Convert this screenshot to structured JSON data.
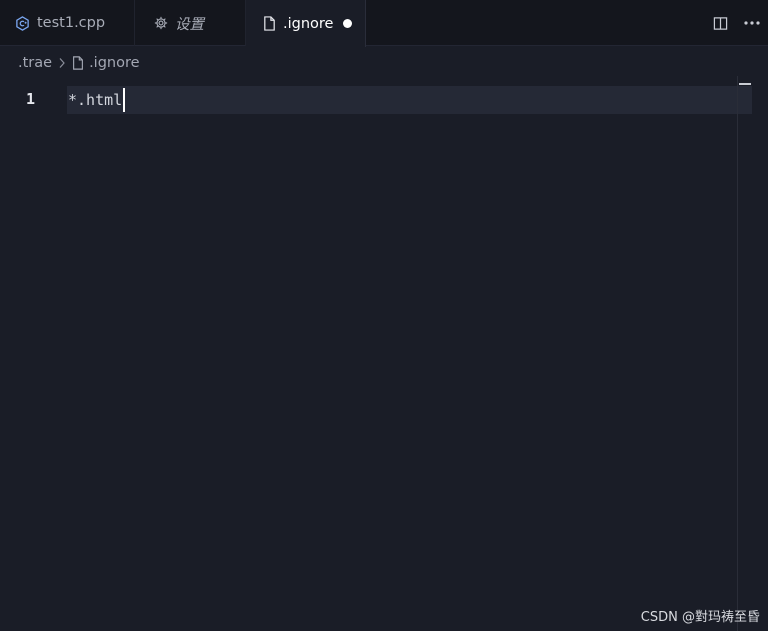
{
  "tabs": [
    {
      "label": "test1.cpp",
      "icon": "cpp-file-icon"
    },
    {
      "label": "设置",
      "icon": "gear-icon"
    },
    {
      "label": ".ignore",
      "icon": "file-icon",
      "active": true,
      "dirty": true
    }
  ],
  "actions": [
    {
      "name": "split-editor",
      "icon": "split-editor-icon"
    },
    {
      "name": "more-actions",
      "icon": "ellipsis-icon"
    }
  ],
  "breadcrumb": {
    "folder": ".trae",
    "file": ".ignore"
  },
  "editor": {
    "lines": [
      {
        "number": "1",
        "text": "*.html"
      }
    ]
  },
  "watermark": "CSDN @對玛祷至昏",
  "colors": {
    "background": "#1a1d27",
    "tabbar": "#14161d",
    "current_line": "#252936",
    "cpp_icon": "#7aa6f0"
  }
}
